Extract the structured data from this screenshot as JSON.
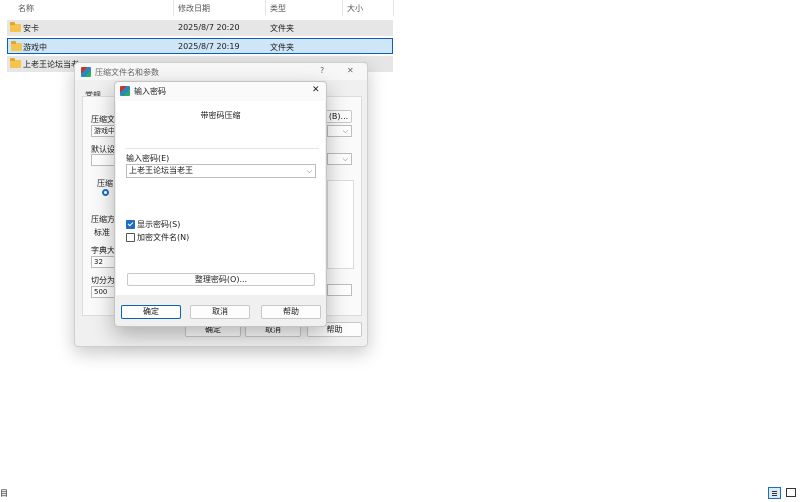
{
  "explorer": {
    "columns": [
      "名称",
      "修改日期",
      "类型",
      "大小"
    ],
    "rows": [
      {
        "name": "安卡",
        "date": "2025/8/7 20:20",
        "type": "文件夹"
      },
      {
        "name": "游戏中",
        "date": "2025/8/7 20:19",
        "type": "文件夹"
      },
      {
        "name": "上老王论坛当老",
        "date": "",
        "type": ""
      }
    ]
  },
  "back_dialog": {
    "title": "压缩文件名和参数",
    "help_glyph": "?",
    "close_glyph": "✕",
    "tab": "常规",
    "labels": [
      "压缩文",
      "游戏中",
      "默认设",
      "压缩",
      "压缩方",
      "标准",
      "字典大",
      "32",
      "切分为",
      "500"
    ],
    "browse_label": "(B)...",
    "ok": "确定",
    "cancel": "取消",
    "help": "帮助"
  },
  "password_dialog": {
    "title": "输入密码",
    "close_glyph": "✕",
    "heading": "带密码压缩",
    "field_label": "输入密码(E)",
    "password_value": "上老王论坛当老王",
    "show_password_label": "显示密码(S)",
    "show_password_checked": true,
    "encrypt_names_label": "加密文件名(N)",
    "encrypt_names_checked": false,
    "organize_button": "整理密码(O)...",
    "ok": "确定",
    "cancel": "取消",
    "help": "帮助"
  },
  "taskbar": {
    "left_glyph": "目"
  }
}
